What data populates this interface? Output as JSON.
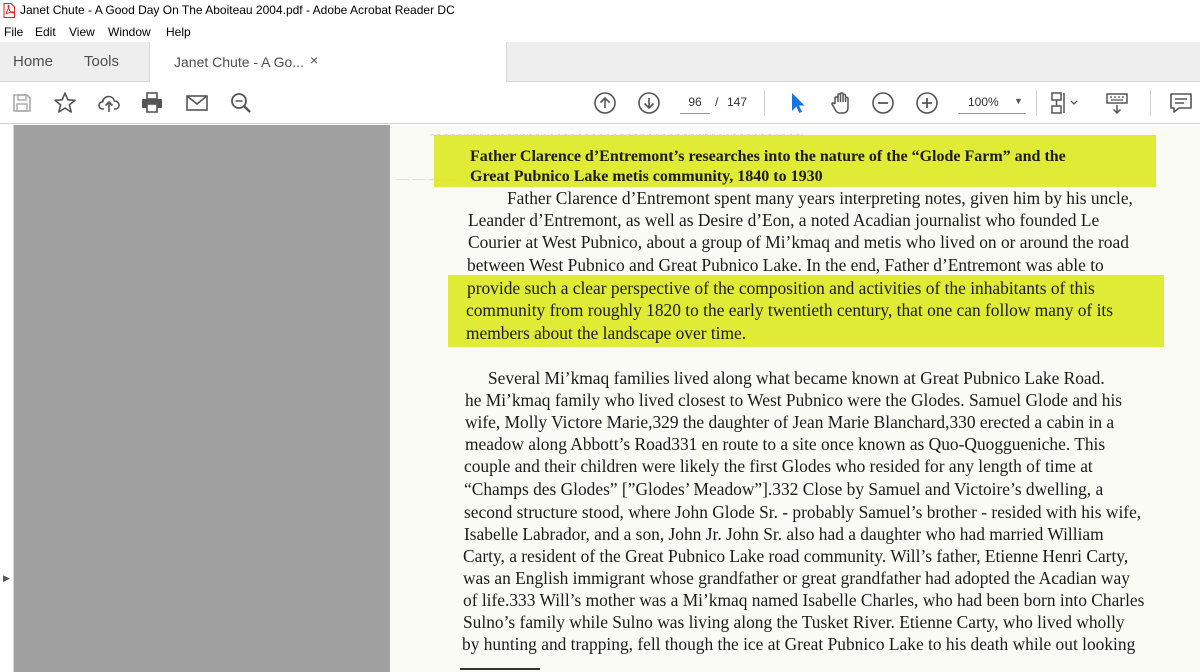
{
  "window": {
    "title": "Janet Chute - A Good Day On The Aboiteau 2004.pdf - Adobe Acrobat Reader DC"
  },
  "menu": [
    "File",
    "Edit",
    "View",
    "Window",
    "Help"
  ],
  "tabs": {
    "home": "Home",
    "tools": "Tools",
    "document": "Janet Chute - A Go...",
    "close": "×"
  },
  "toolbar": {
    "page_current": "96",
    "page_separator": "/",
    "page_total": "147",
    "zoom": "100%",
    "zoom_caret": "▼"
  },
  "sidebar": {
    "expand": "▶"
  },
  "document": {
    "heading_lines": [
      "Father Clarence d’Entremont’s researches into the nature of the “Glode Farm” and the",
      "Great Pubnico Lake metis community, 1840 to 1930"
    ],
    "para1": [
      "Father Clarence d’Entremont spent many years interpreting notes, given him by his uncle,",
      "Leander d’Entremont, as well as Desire d’Eon, a noted Acadian journalist who founded Le",
      "Courier at West Pubnico, about a group of Mi’kmaq and metis who lived on or around the road",
      "between West Pubnico and Great Pubnico Lake. In the end, Father d’Entremont was able to",
      "provide such a clear perspective of the composition and activities of the inhabitants of this",
      "community from roughly 1820 to the early twentieth century, that one can follow many of its",
      "members about the landscape over time."
    ],
    "para2": [
      "Several Mi’kmaq families lived along what became known at Great Pubnico Lake Road.",
      "he Mi’kmaq family who lived closest to West Pubnico were the Glodes. Samuel Glode and his",
      "wife, Molly Victore Marie,329 the daughter of Jean Marie Blanchard,330 erected a cabin in a",
      "meadow  along Abbott’s Road331 en route to a site once known as Quo-Quoggueniche. This",
      "couple and their children were likely the first Glodes who resided for any length of time at",
      "“Champs des Glodes” [”Glodes’ Meadow”].332  Close by Samuel and Victoire’s dwelling, a",
      "second structure stood, where John Glode Sr. - probably Samuel’s brother - resided with his wife,",
      "Isabelle Labrador, and a son, John Jr.  John Sr. also had a daughter who had married William",
      "Carty, a resident of the Great Pubnico Lake road community.  Will’s father, Etienne Henri Carty,",
      "was an English immigrant whose grandfather or great grandfather had adopted the Acadian way",
      "of life.333  Will’s mother was a Mi’kmaq named Isabelle Charles, who had been born into Charles",
      "Sulno’s family while Sulno was living along the Tusket River. Etienne Carty, who lived wholly",
      "by hunting and trapping, fell though the ice at Great Pubnico Lake to his death while out looking"
    ]
  },
  "colors": {
    "highlight": "#dce81a",
    "canvas": "#a0a0a0",
    "tabbar": "#eeeeee",
    "select_tool": "#1473e6",
    "pdf_icon": "#e0201b"
  }
}
